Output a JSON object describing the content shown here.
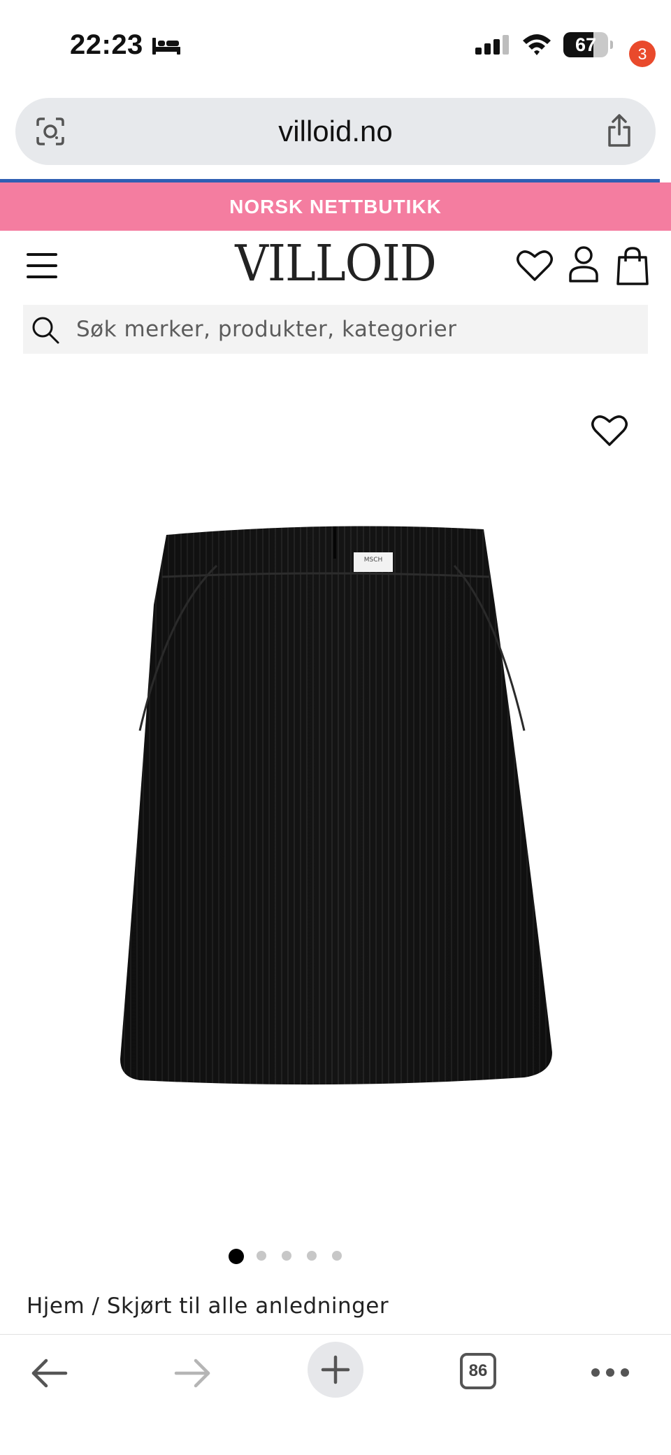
{
  "status_bar": {
    "time": "22:23",
    "battery": {
      "percent": 67,
      "label": "67"
    },
    "icons": [
      "bed-icon",
      "cellular-signal-icon",
      "wifi-icon",
      "battery-icon"
    ]
  },
  "browser": {
    "url": "villoid.no",
    "icons": [
      "camera-search-icon",
      "share-icon"
    ],
    "accent": "#2f5fb3"
  },
  "promo_banner": {
    "text": "NORSK NETTBUTIKK",
    "background": "#f47da0"
  },
  "header": {
    "logo": "VILLOID",
    "cart_count": "3",
    "badge_color": "#e94a2c",
    "icons": [
      "menu-icon",
      "heart-icon",
      "user-icon",
      "shopping-bag-icon"
    ]
  },
  "search": {
    "placeholder": "Søk merker, produkter, kategorier"
  },
  "product": {
    "image_label": "MSCH",
    "icons": [
      "wishlist-heart-icon"
    ]
  },
  "carousel": {
    "total": 5,
    "active_index": 0
  },
  "breadcrumb": {
    "text": "Hjem / Skjørt til alle anledninger"
  },
  "toolbar": {
    "tab_count": "86",
    "icons": [
      "back-arrow-icon",
      "forward-arrow-icon",
      "plus-icon",
      "tabs-icon",
      "more-icon"
    ]
  }
}
